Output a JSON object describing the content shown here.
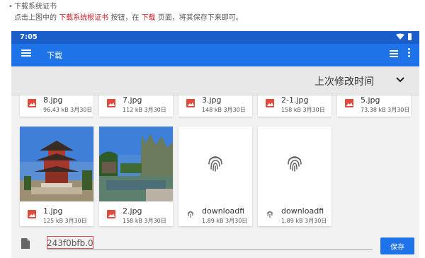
{
  "instructions": {
    "title": "下载系统证书",
    "line2_prefix": "点击上图中的",
    "line2_button": "下载系统根证书",
    "line2_mid1": "按钮，在",
    "line2_page": "下载",
    "line2_suffix": "页面，将其保存下来即可。"
  },
  "status": {
    "time": "7:05",
    "icons": "▼▮"
  },
  "appbar": {
    "title": "下载"
  },
  "sort": {
    "label": "上次修改时间"
  },
  "files_row1": [
    {
      "name": "8.jpg",
      "meta": "96.43 kB 3月30日"
    },
    {
      "name": "7.jpg",
      "meta": "112 kB 3月30日"
    },
    {
      "name": "3.jpg",
      "meta": "148 kB 3月30日"
    },
    {
      "name": "2-1.jpg",
      "meta": "158 kB 3月30日"
    },
    {
      "name": "5.jpg",
      "meta": "73.38 kB 3月30日"
    }
  ],
  "files_row2": [
    {
      "name": "1.jpg",
      "meta": "125 kB 3月30日"
    },
    {
      "name": "2.jpg",
      "meta": "158 kB 3月30日"
    },
    {
      "name": "downloadfi",
      "meta": "1.89 kB 3月30日"
    },
    {
      "name": "downloadfi",
      "meta": "1.89 kB 3月30日"
    }
  ],
  "save_bar": {
    "filename": "243f0bfb.0",
    "save_label": "保存"
  },
  "colors": {
    "accent": "#1e73e8",
    "statusbar": "#1a5fc9",
    "image_icon": "#e04a3f",
    "highlight": "#d0202a"
  }
}
